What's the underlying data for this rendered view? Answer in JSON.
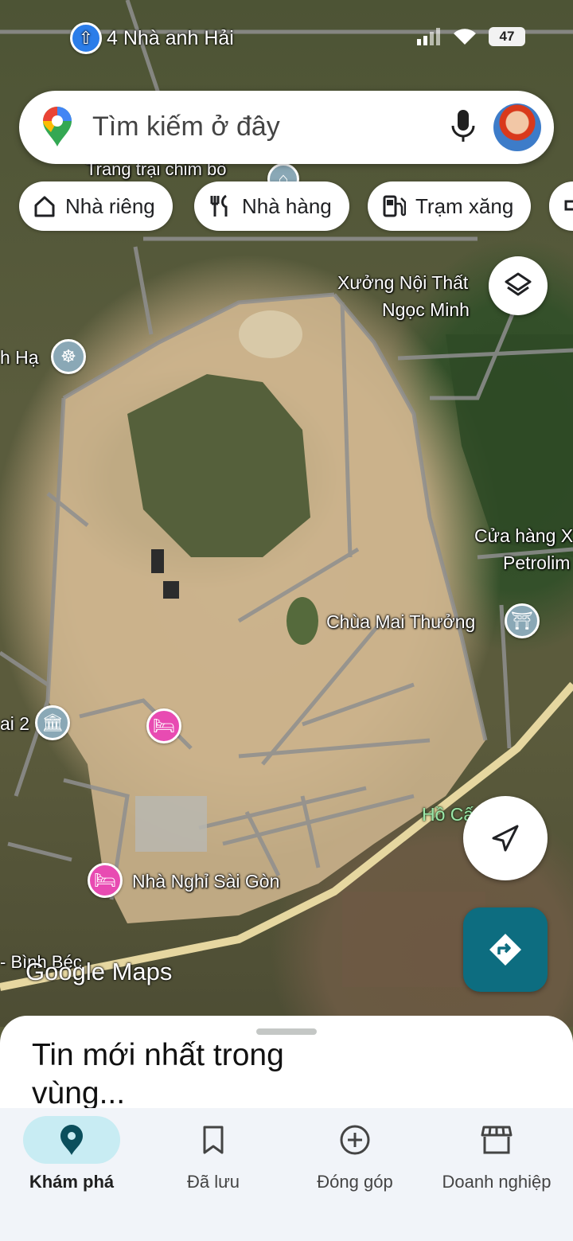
{
  "status_bar": {
    "notification_text": "4 Nhà anh Hải",
    "battery": "47"
  },
  "search": {
    "placeholder": "Tìm kiếm ở đây",
    "logo_icon": "google-maps-pin-icon",
    "mic_icon": "microphone-icon"
  },
  "chips": [
    {
      "label": "Nhà riêng",
      "icon": "home-icon"
    },
    {
      "label": "Nhà hàng",
      "icon": "restaurant-icon"
    },
    {
      "label": "Trạm xăng",
      "icon": "gas-station-icon"
    }
  ],
  "map_labels": {
    "trang_trai": "Trang trại chim bồ",
    "xuong_line1": "Xưởng Nội Thất",
    "xuong_line2": "Ngọc Minh",
    "h_ha": "h Hạ",
    "cua_hang_line1": "Cửa hàng X",
    "cua_hang_line2": "Petrolim",
    "chua": "Chùa Mai Thưởng",
    "ai2": "ai 2",
    "ho_cam_son": "Hồ Cấm Sơn",
    "nha_nghi": "Nhà Nghỉ Sài Gòn",
    "binh_bec": "- Bình Béc",
    "google_maps": "Google Maps"
  },
  "sheet": {
    "title": "Tin mới nhất trong vùng..."
  },
  "bottom_nav": [
    {
      "label": "Khám phá",
      "icon": "explore-pin-icon",
      "active": true
    },
    {
      "label": "Đã lưu",
      "icon": "bookmark-icon",
      "active": false
    },
    {
      "label": "Đóng góp",
      "icon": "add-circle-icon",
      "active": false
    },
    {
      "label": "Doanh nghiệp",
      "icon": "storefront-icon",
      "active": false
    }
  ],
  "colors": {
    "accent_teal": "#0d6d80",
    "nav_active_bg": "#c8ecf3",
    "hotel_pin": "#e84bb2",
    "landmark_pin": "#8aa8b6"
  }
}
